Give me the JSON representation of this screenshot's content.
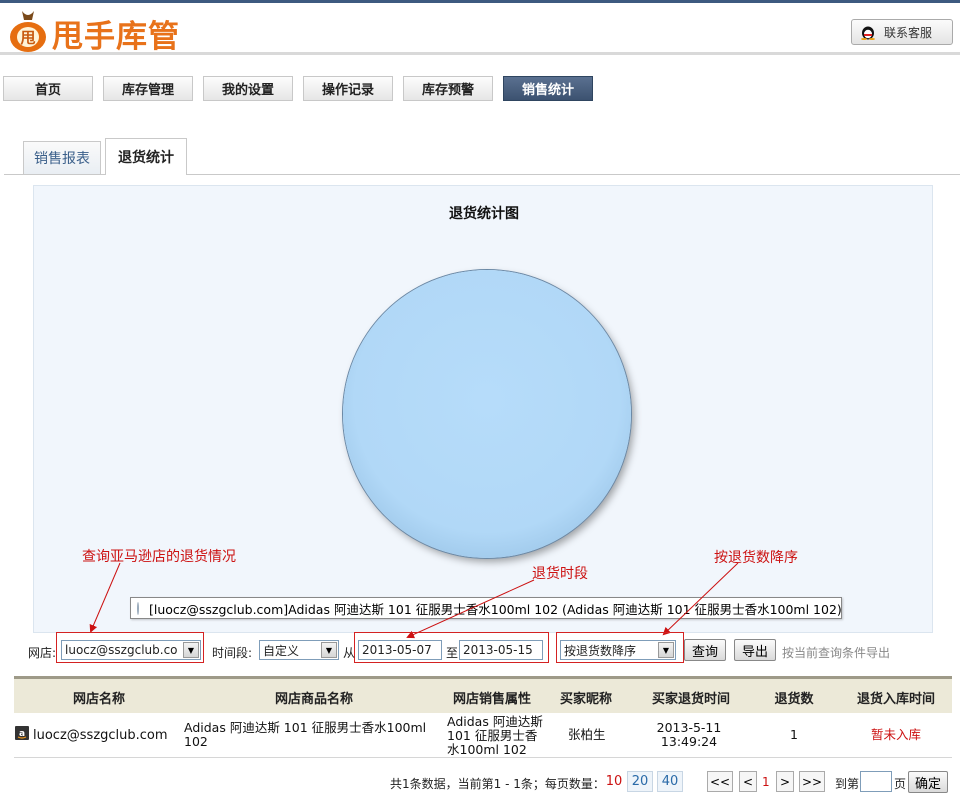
{
  "app": {
    "logo_char": "甩",
    "logo_text": "甩手库管",
    "support_label": "联系客服"
  },
  "nav": [
    {
      "label": "首页",
      "active": false
    },
    {
      "label": "库存管理",
      "active": false
    },
    {
      "label": "我的设置",
      "active": false
    },
    {
      "label": "操作记录",
      "active": false
    },
    {
      "label": "库存预警",
      "active": false
    },
    {
      "label": "销售统计",
      "active": true
    }
  ],
  "tabs": [
    {
      "label": "销售报表",
      "active": false
    },
    {
      "label": "退货统计",
      "active": true
    }
  ],
  "chart_data": {
    "type": "pie",
    "title": "退货统计图",
    "slices": [
      {
        "label": "[luocz@sszgclub.com]Adidas 阿迪达斯 101 征服男士香水100ml 102 (Adidas 阿迪达斯 101 征服男士香水100ml 102)",
        "value": 1
      }
    ],
    "tooltip": "[luocz@sszgclub.com]Adidas 阿迪达斯 101 征服男士香水100ml 102 (Adidas 阿迪达斯 101 征服男士香水100ml 102)",
    "colors": {
      "slice": "#b3d9f8"
    }
  },
  "annotations": {
    "shop": "查询亚马逊店的退货情况",
    "period": "退货时段",
    "sort": "按退货数降序"
  },
  "filter": {
    "shop_label": "网店:",
    "shop_value": "luocz@sszgclub.co",
    "period_label": "时间段:",
    "period_value": "自定义",
    "from_label": "从",
    "from_date": "2013-05-07",
    "to_label": "至",
    "to_date": "2013-05-15",
    "sort_value": "按退货数降序",
    "query_button": "查询",
    "export_button": "导出",
    "export_hint": "按当前查询条件导出"
  },
  "table": {
    "headers": [
      "网店名称",
      "网店商品名称",
      "网店销售属性",
      "买家昵称",
      "买家退货时间",
      "退货数",
      "退货入库时间"
    ],
    "rows": [
      {
        "shop": "luocz@sszgclub.com",
        "product": "Adidas 阿迪达斯 101 征服男士香水100ml 102",
        "attr": "Adidas 阿迪达斯 101 征服男士香水100ml 102",
        "buyer": "张柏生",
        "return_time": "2013-5-11 13:49:24",
        "qty": "1",
        "stock_time": "暂未入库"
      }
    ]
  },
  "pager": {
    "summary": "共1条数据，当前第1 - 1条；每页数量：",
    "sizes": [
      "10",
      "20",
      "40"
    ],
    "first": "<<",
    "prev": "<",
    "current": "1",
    "next": ">",
    "last": ">>",
    "goto_label": "到第",
    "page_unit": "页",
    "confirm": "确定",
    "goto_value": ""
  },
  "colors": {
    "accent": "#e8721a",
    "nav_active": "#465c7c",
    "annotation": "#cc1111",
    "chart_bg": "#f1f6fc"
  }
}
